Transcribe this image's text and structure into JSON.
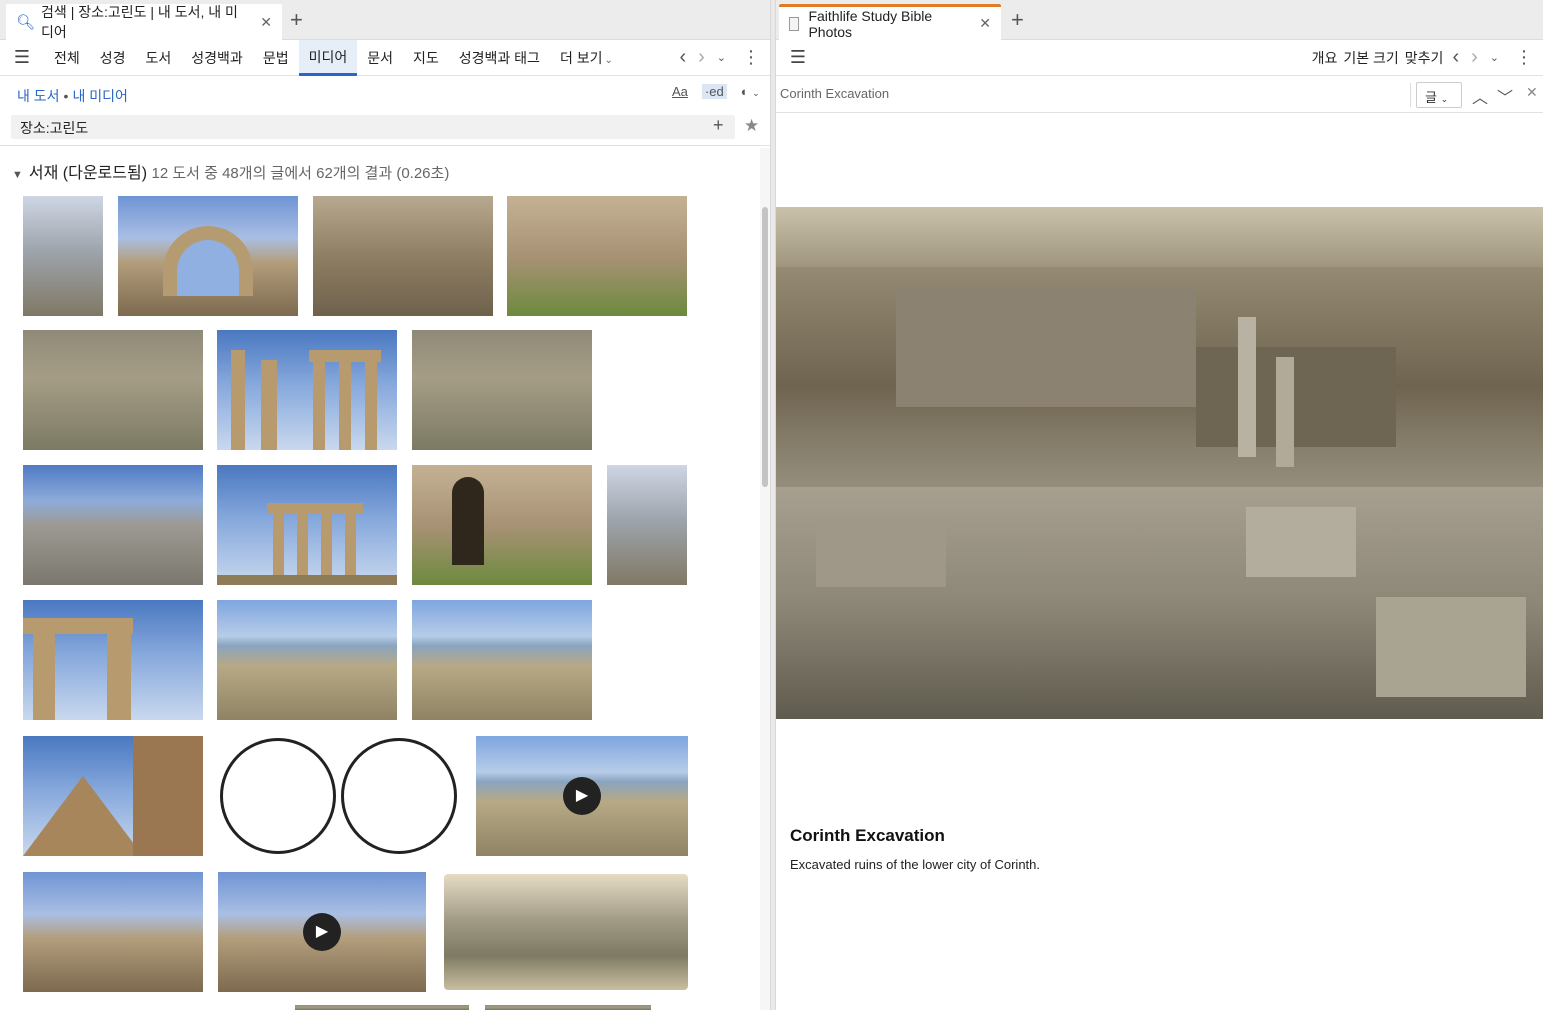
{
  "left": {
    "tab": {
      "icon": "search-icon",
      "title": "검색 | 장소:고린도 | 내 도서, 내 미디어"
    },
    "nav_tabs": [
      "전체",
      "성경",
      "도서",
      "성경백과",
      "문법",
      "미디어",
      "문서",
      "지도",
      "성경백과 태그",
      "더 보기"
    ],
    "active_tab": "미디어",
    "breadcrumb": {
      "first": "내 도서",
      "second": "내 미디어"
    },
    "tools": {
      "font": "Aa",
      "ed": "·ed"
    },
    "query": "장소:고린도",
    "results": {
      "heading": "서재 (다운로드됨)",
      "summary": "12 도서 중 48개의 글에서 62개의 결과 (0.26초)"
    }
  },
  "right": {
    "tab": {
      "icon": "document-icon",
      "title": "Faithlife Study Bible Photos"
    },
    "toolbar": {
      "overview": "개요",
      "default_size": "기본 크기",
      "fit": "맞추기"
    },
    "find": {
      "value": "Corinth Excavation",
      "select": "글"
    },
    "caption": {
      "title": "Corinth Excavation",
      "text": "Excavated ruins of the lower city of Corinth."
    }
  },
  "colors": {
    "accent": "#2a66c5",
    "tab_underline": "#e07b2a"
  },
  "icons": [
    "menu-icon",
    "chevron-left-icon",
    "chevron-right-icon",
    "chevron-down-icon",
    "kebab-icon",
    "plus-icon",
    "star-icon",
    "close-icon",
    "play-icon",
    "chevron-up-icon"
  ]
}
